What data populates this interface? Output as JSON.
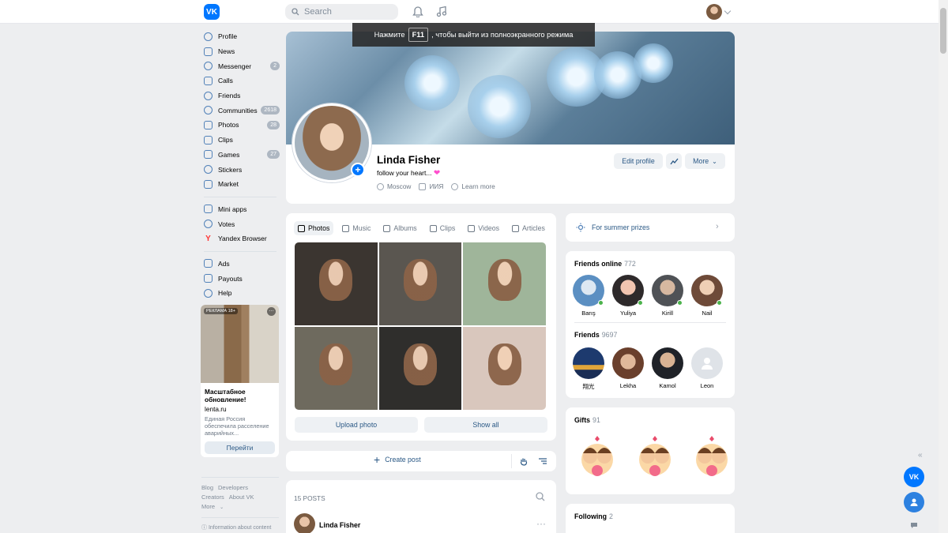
{
  "topbar": {
    "logo_text": "VK",
    "search_placeholder": "Search"
  },
  "fullscreen_notice": {
    "before": "Нажмите",
    "key": "F11",
    "after": ", чтобы выйти из полноэкранного режима"
  },
  "sidebar": {
    "items": [
      {
        "label": "Profile",
        "badge": ""
      },
      {
        "label": "News",
        "badge": ""
      },
      {
        "label": "Messenger",
        "badge": "2"
      },
      {
        "label": "Calls",
        "badge": ""
      },
      {
        "label": "Friends",
        "badge": ""
      },
      {
        "label": "Communities",
        "badge": "2618"
      },
      {
        "label": "Photos",
        "badge": "28"
      },
      {
        "label": "Clips",
        "badge": ""
      },
      {
        "label": "Games",
        "badge": "27"
      },
      {
        "label": "Stickers",
        "badge": ""
      },
      {
        "label": "Market",
        "badge": ""
      }
    ],
    "items2": [
      {
        "label": "Mini apps"
      },
      {
        "label": "Votes"
      },
      {
        "label": "Yandex Browser"
      }
    ],
    "items3": [
      {
        "label": "Ads"
      },
      {
        "label": "Payouts"
      },
      {
        "label": "Help"
      }
    ]
  },
  "ad": {
    "badge": "РЕКЛАМА 18+",
    "title": "Масштабное обновление!",
    "domain": "lenta.ru",
    "text": "Единая Россия обеспечила расселение аварийных...",
    "button": "Перейти"
  },
  "footer": {
    "links": [
      "Blog",
      "Developers",
      "Creators",
      "About VK",
      "More"
    ],
    "info": "Information about content"
  },
  "profile": {
    "name": "Linda Fisher",
    "status": "follow your heart...",
    "city": "Moscow",
    "work": "ИИЯ",
    "learn_more": "Learn more",
    "edit_button": "Edit profile",
    "more_button": "More"
  },
  "media_tabs": [
    "Photos",
    "Music",
    "Albums",
    "Clips",
    "Videos",
    "Articles"
  ],
  "photos": {
    "upload_button": "Upload photo",
    "show_all_button": "Show all"
  },
  "create_post": "Create post",
  "posts": {
    "count_label": "15 POSTS",
    "first_author": "Linda Fisher"
  },
  "promo": {
    "label": "For summer prizes"
  },
  "friends_online": {
    "title": "Friends online",
    "count": "772",
    "people": [
      "Barış",
      "Yuliya",
      "Kirill",
      "Nail"
    ]
  },
  "friends": {
    "title": "Friends",
    "count": "9697",
    "people": [
      "翔光",
      "Lekha",
      "Kamol",
      "Leon"
    ]
  },
  "gifts": {
    "title": "Gifts",
    "count": "91"
  },
  "following": {
    "title": "Following",
    "count": "2"
  },
  "colors": {
    "accent": "#0077ff",
    "link": "#2a5885",
    "online": "#4bb34b"
  }
}
